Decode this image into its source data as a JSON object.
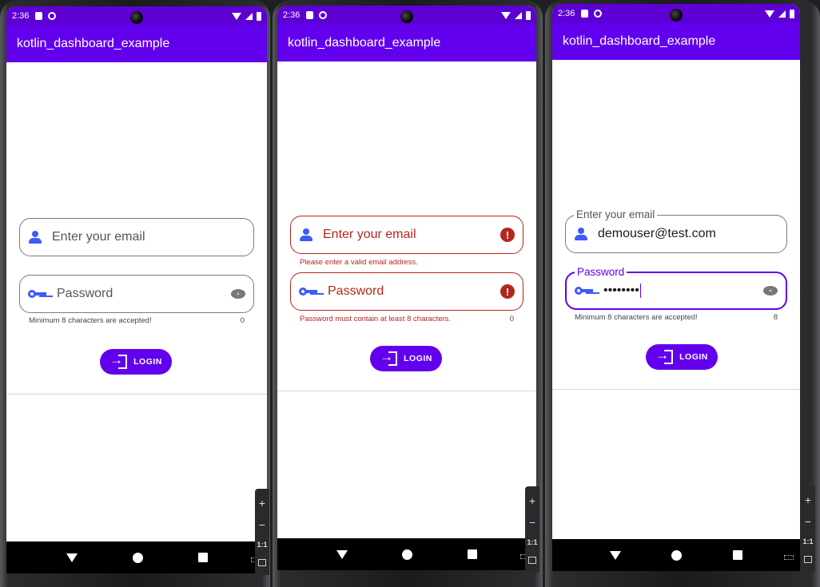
{
  "status_time": "2:36",
  "app_title": "kotlin_dashboard_example",
  "email_placeholder": "Enter your email",
  "password_label": "Password",
  "email_label": "Enter your email",
  "email_value": "demouser@test.com",
  "password_value": "••••••••",
  "helper_min_chars": "Minimum 8 characters are accepted!",
  "error_email": "Please enter a valid email address.",
  "error_password": "Password must contain at least 8 characters.",
  "counter_empty": "0",
  "counter_filled": "8",
  "login_label": "LOGIN",
  "zoom": {
    "plus": "+",
    "minus": "−",
    "one_to_one": "1:1"
  },
  "colors": {
    "primary": "#6200ee",
    "status_bar": "#5c00d4",
    "icon_blue": "#3d5afe",
    "error": "#b3261e"
  },
  "icons": [
    "person-icon",
    "key-icon",
    "eye-icon",
    "error-icon",
    "login-icon"
  ],
  "screens": [
    {
      "state": "empty"
    },
    {
      "state": "error"
    },
    {
      "state": "filled"
    }
  ]
}
